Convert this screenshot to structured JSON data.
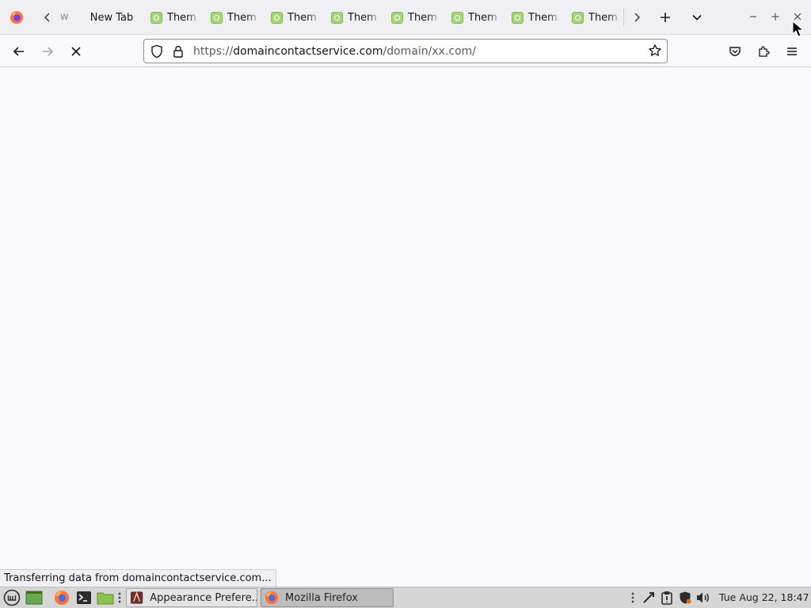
{
  "browser": {
    "tabs": {
      "partial_tab_label": "w",
      "newtab_label": "New Tab",
      "theme_tabs": [
        "Them",
        "Them",
        "Them",
        "Them",
        "Them",
        "Them",
        "Them",
        "Them"
      ]
    },
    "url": {
      "protocol": "https://",
      "host": "domaincontactservice.com",
      "path": "/domain/xx.com/"
    },
    "status_text": "Transferring data from domaincontactservice.com..."
  },
  "taskbar": {
    "windows": [
      {
        "label": "Appearance Prefere..."
      },
      {
        "label": "Mozilla Firefox"
      }
    ],
    "clock": "Tue Aug 22, 18:47"
  },
  "colors": {
    "firefox_orange": "#ff7139",
    "theme_favicon": "#a7d67a",
    "content_bg": "#f9f9fb"
  }
}
